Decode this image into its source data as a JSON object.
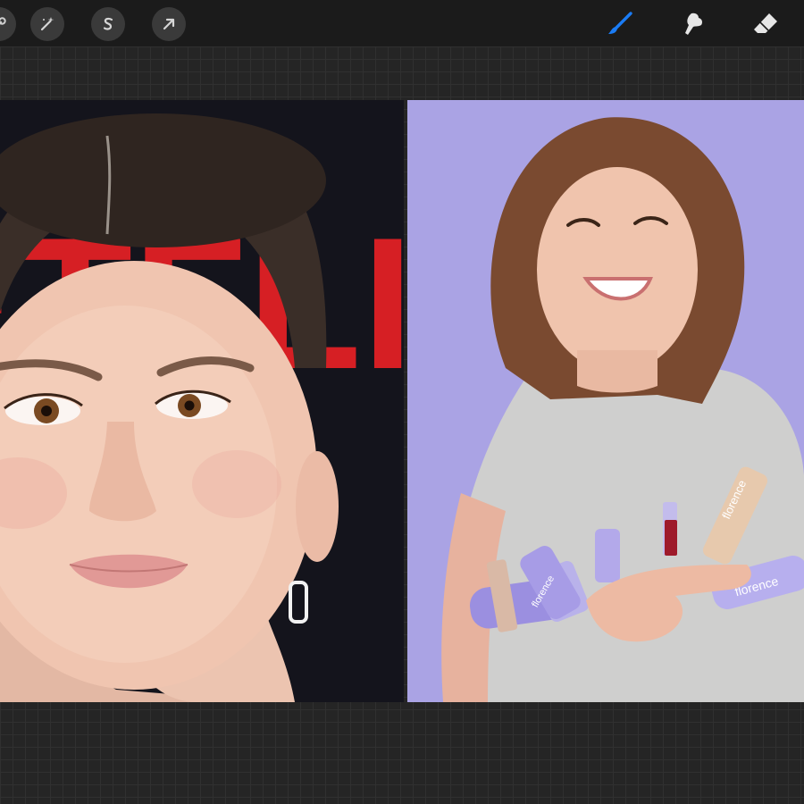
{
  "toolbar": {
    "left_tools": [
      {
        "name": "wrench-icon"
      },
      {
        "name": "magic-wand-icon"
      },
      {
        "name": "selection-s-icon"
      },
      {
        "name": "transform-arrow-icon"
      }
    ],
    "right_tools": [
      {
        "name": "brush-icon",
        "active": true
      },
      {
        "name": "smudge-icon"
      },
      {
        "name": "eraser-icon"
      }
    ],
    "active_color": "#1a7cf5"
  },
  "canvas": {
    "images": [
      {
        "name": "portrait-left",
        "background": "#15151e",
        "logo_text": "ETFLIX",
        "logo_color": "#d61f24"
      },
      {
        "name": "portrait-right",
        "background": "#a9a3e3",
        "product_texts": [
          "florence",
          "florence",
          "florence"
        ]
      }
    ]
  }
}
